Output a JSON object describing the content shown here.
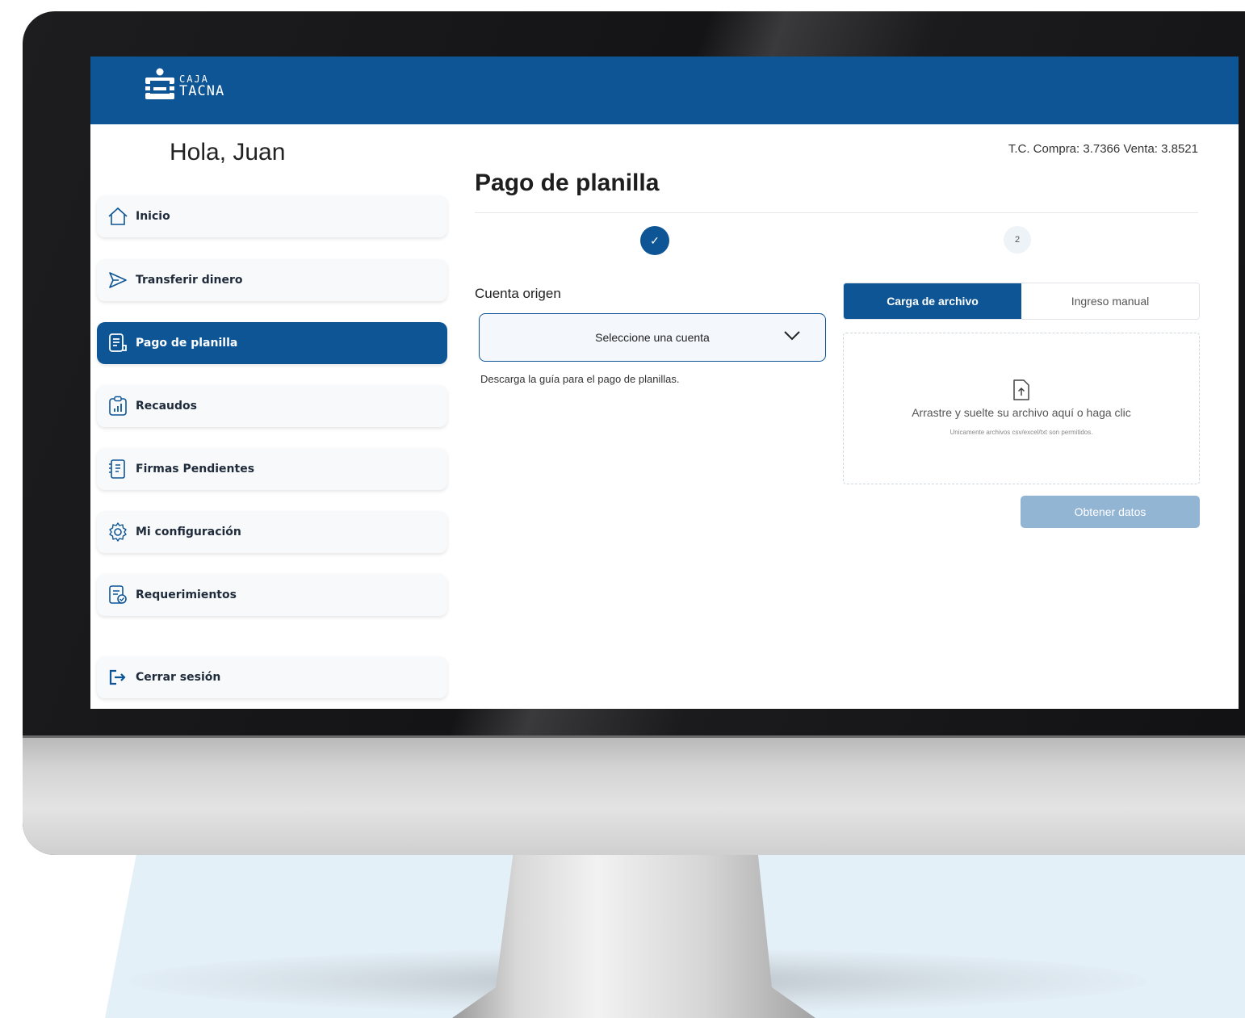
{
  "brand": {
    "logo_line1": "CAJA",
    "logo_line2": "TACNA",
    "primary_color": "#0e5596"
  },
  "sidebar": {
    "greeting": "Hola, Juan",
    "items": [
      {
        "label": "Inicio",
        "icon": "home-icon",
        "active": false
      },
      {
        "label": "Transferir dinero",
        "icon": "send-icon",
        "active": false
      },
      {
        "label": "Pago de planilla",
        "icon": "document-icon",
        "active": true
      },
      {
        "label": "Recaudos",
        "icon": "chart-clipboard-icon",
        "active": false
      },
      {
        "label": "Firmas Pendientes",
        "icon": "signature-list-icon",
        "active": false
      },
      {
        "label": "Mi configuración",
        "icon": "gear-icon",
        "active": false
      },
      {
        "label": "Requerimientos",
        "icon": "request-document-icon",
        "active": false
      }
    ],
    "logout_label": "Cerrar sesión"
  },
  "header": {
    "exchange_rate": "T.C. Compra: 3.7366 Venta: 3.8521"
  },
  "main": {
    "title": "Pago de planilla",
    "stepper": {
      "step1_label": "✓",
      "step2_label": "2"
    },
    "account": {
      "label": "Cuenta origen",
      "select_value": "Seleccione una cuenta",
      "guide_link": "Descarga la guía para el pago de planillas."
    },
    "tabs": [
      {
        "label": "Carga de archivo",
        "active": true
      },
      {
        "label": "Ingreso manual",
        "active": false
      }
    ],
    "dropzone": {
      "main_text": "Arrastre y suelte su archivo aquí o haga clic",
      "sub_text": "Unicamente archivos csv/excel/txt son permitidos."
    },
    "submit_label": "Obtener datos"
  }
}
